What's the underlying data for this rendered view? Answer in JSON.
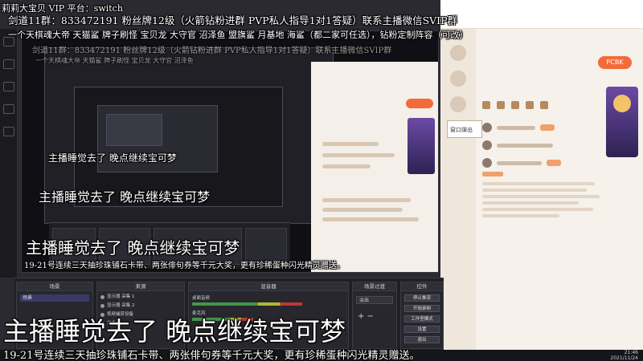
{
  "overlay": {
    "platform_line": "莉莉大宝贝 VIP 平台：switch",
    "group_line": "剑道11群：833472191 粉丝牌12级（火箭钻粉进群 PVP私人指导1对1答疑）联系主播微信SVIP群",
    "info_line": "一个天棋魂大帝 天猫鲨 牌子刷怪 宝贝龙 大守官 沼泽鱼 盟旗鲨 月基地 海鲨（都二家可任选），钻粉定制阵容（可改）",
    "ghost_line_1": "剑道11群：833472191 粉丝牌12级（火箭钻粉进群 PVP私人指导1对1答疑）联系主播微信SVIP群",
    "ghost_line_2": "一个天棋魂大帝 天猫鲨 牌子刷怪 宝贝龙 大守官 沼泽鱼",
    "sleep_caption": "主播睡觉去了 晚点继续宝可梦",
    "ticker": "19-21号连续三天抽珍珠铺石卡带、两张俳句券等千元大奖，更有珍稀蛋种闪光精灵赠送。"
  },
  "stream_page": {
    "popup_label": "窗口弹出",
    "pill_label": "PCBK"
  },
  "obs": {
    "panels": {
      "scenes": "场景",
      "sources": "来源",
      "mixer": "混音器",
      "transitions": "场景过渡",
      "controls": "控件"
    },
    "scenes": [
      "场景"
    ],
    "sources": [
      "显示器 采集 1",
      "显示器 采集 2",
      "视频捕获设备",
      "文本"
    ],
    "mixer": [
      {
        "label": "桌面音频",
        "level": 0.72
      },
      {
        "label": "麦克风",
        "level": 0.4
      }
    ],
    "transition_value": "淡出",
    "controls": [
      "停止推流",
      "开始录制",
      "工作室模式",
      "设置",
      "退出"
    ]
  },
  "taskbar": {
    "time": "21:46",
    "date": "2021/11/24"
  }
}
